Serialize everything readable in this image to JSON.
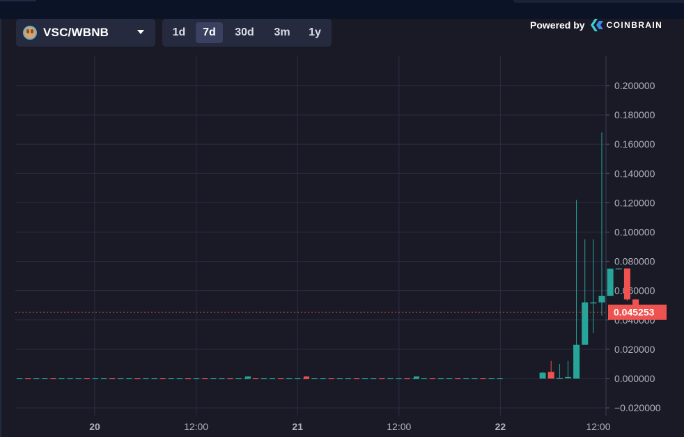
{
  "toolbar": {
    "pair_label": "VSC/WBNB",
    "pair_icon": "pancake-bunny-icon",
    "ranges": [
      {
        "label": "1d",
        "active": false
      },
      {
        "label": "7d",
        "active": true
      },
      {
        "label": "30d",
        "active": false
      },
      {
        "label": "3m",
        "active": false
      },
      {
        "label": "1y",
        "active": false
      }
    ]
  },
  "branding": {
    "powered_by": "Powered by",
    "brand": "COINBRAIN",
    "logo_icon": "coinbrain-logo-icon"
  },
  "colors": {
    "background": "#1a1a26",
    "grid": "#2a2e45",
    "up": "#26a69a",
    "down": "#ef5350",
    "last_price_line": "#ef5350"
  },
  "chart_data": {
    "type": "candlestick",
    "title": "",
    "xlabel": "",
    "ylabel": "",
    "ylim": [
      -0.025,
      0.21
    ],
    "yticks": [
      "0.200000",
      "0.180000",
      "0.160000",
      "0.140000",
      "0.120000",
      "0.100000",
      "0.080000",
      "0.060000",
      "0.040000",
      "0.020000",
      "0.000000",
      "−0.020000"
    ],
    "xticks": [
      "20",
      "12:00",
      "21",
      "12:00",
      "22",
      "12:00"
    ],
    "grid": true,
    "last_price": 0.045253,
    "last_price_label": "0.045253",
    "candles": [
      {
        "t": "2021-10-22T05:00",
        "o": 0.0,
        "h": 0.0045,
        "l": 0.0,
        "c": 0.004
      },
      {
        "t": "2021-10-22T06:00",
        "o": 0.0045,
        "h": 0.012,
        "l": 0.0,
        "c": 0.0
      },
      {
        "t": "2021-10-22T07:00",
        "o": 0.0,
        "h": 0.01,
        "l": 0.0,
        "c": 0.0005
      },
      {
        "t": "2021-10-22T08:00",
        "o": 0.0005,
        "h": 0.012,
        "l": 0.0,
        "c": 0.001
      },
      {
        "t": "2021-10-22T09:00",
        "o": 0.0,
        "h": 0.122,
        "l": 0.0,
        "c": 0.023
      },
      {
        "t": "2021-10-22T10:00",
        "o": 0.023,
        "h": 0.095,
        "l": 0.023,
        "c": 0.052
      },
      {
        "t": "2021-10-22T11:00",
        "o": 0.052,
        "h": 0.095,
        "l": 0.031,
        "c": 0.052
      },
      {
        "t": "2021-10-22T12:00",
        "o": 0.052,
        "h": 0.168,
        "l": 0.043,
        "c": 0.0565
      },
      {
        "t": "2021-10-22T13:00",
        "o": 0.0565,
        "h": 0.075,
        "l": 0.0565,
        "c": 0.075
      },
      {
        "t": "2021-10-22T14:00",
        "o": 0.075,
        "h": 0.075,
        "l": 0.075,
        "c": 0.0752
      },
      {
        "t": "2021-10-22T15:00",
        "o": 0.0752,
        "h": 0.0752,
        "l": 0.053,
        "c": 0.054
      },
      {
        "t": "2021-10-22T16:00",
        "o": 0.054,
        "h": 0.054,
        "l": 0.045,
        "c": 0.0453
      }
    ]
  }
}
